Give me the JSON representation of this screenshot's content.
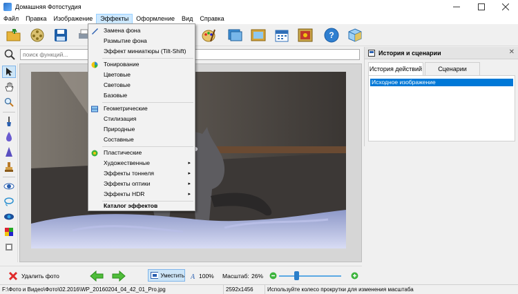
{
  "window": {
    "title": "Домашняя Фотостудия"
  },
  "menu": [
    {
      "label": "Файл"
    },
    {
      "label": "Правка"
    },
    {
      "label": "Изображение"
    },
    {
      "label": "Эффекты"
    },
    {
      "label": "Оформление"
    },
    {
      "label": "Вид"
    },
    {
      "label": "Справка"
    }
  ],
  "search": {
    "placeholder": "поиск функций..."
  },
  "effects_menu": {
    "items": [
      {
        "label": "Замена фона"
      },
      {
        "label": "Размытие фона"
      },
      {
        "label": "Эффект миниатюры (Tilt-Shift)"
      },
      {
        "label": "Тонирование"
      },
      {
        "label": "Цветовые"
      },
      {
        "label": "Световые"
      },
      {
        "label": "Базовые"
      },
      {
        "label": "Геометрические"
      },
      {
        "label": "Стилизация"
      },
      {
        "label": "Природные"
      },
      {
        "label": "Составные"
      },
      {
        "label": "Пластические"
      },
      {
        "label": "Художественные",
        "submenu": "▸"
      },
      {
        "label": "Эффекты тоннеля",
        "submenu": "▸"
      },
      {
        "label": "Эффекты оптики",
        "submenu": "▸"
      },
      {
        "label": "Эффекты HDR",
        "submenu": "▸"
      },
      {
        "label": "Каталог эффектов"
      }
    ]
  },
  "panel": {
    "title": "История и сценарии",
    "close": "✕",
    "tabs": [
      {
        "label": "История действий"
      },
      {
        "label": "Сценарии"
      }
    ],
    "history": [
      {
        "label": "Исходное изображение"
      }
    ]
  },
  "bottom": {
    "delete_label": "Удалить фото",
    "fit_label": "Уместить",
    "actual_label": "100%",
    "zoom_label": "Масштаб:",
    "zoom_value": "26%",
    "zoom_level": 0.28
  },
  "status": {
    "path": "F:\\Фото и Видео\\Фото\\02.2016\\WP_20160204_04_42_01_Pro.jpg",
    "dimensions": "2592x1456",
    "hint": "Используйте колесо прокрутки для изменения масштаба"
  },
  "colors": {
    "selection": "#0078d7",
    "menu_highlight": "#cce8ff",
    "accent": "#2c7fc9"
  }
}
